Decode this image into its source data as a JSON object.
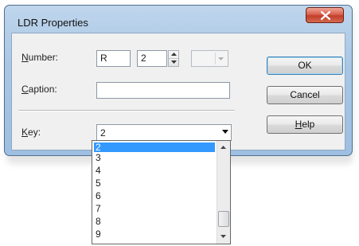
{
  "window": {
    "title": "LDR Properties"
  },
  "form": {
    "number_label_u": "N",
    "number_label_rest": "umber:",
    "number_prefix_value": "R",
    "number_value": "2",
    "caption_label_u": "C",
    "caption_label_rest": "aption:",
    "caption_value": "",
    "key_label_u": "K",
    "key_label_rest": "ey:",
    "key_value": "2"
  },
  "buttons": {
    "ok": "OK",
    "cancel": "Cancel",
    "help_u": "H",
    "help_rest": "elp"
  },
  "key_dropdown": {
    "items": [
      "2",
      "3",
      "4",
      "5",
      "6",
      "7",
      "8",
      "9"
    ],
    "selected": "2"
  },
  "colors": {
    "selection": "#3399ff",
    "close_button": "#c94a36",
    "title_bar": "#a9c6e4"
  }
}
